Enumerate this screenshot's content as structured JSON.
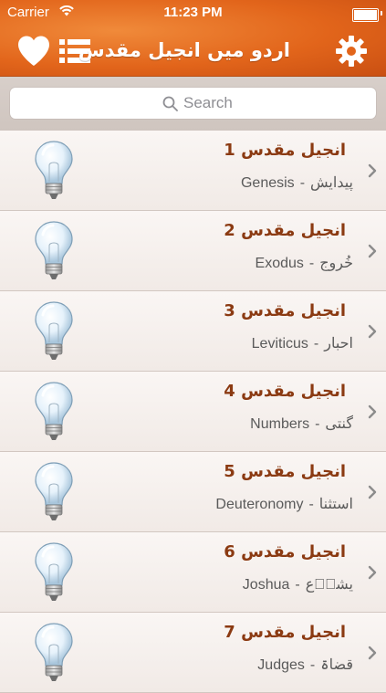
{
  "status_bar": {
    "carrier": "Carrier",
    "time": "11:23 PM"
  },
  "nav": {
    "title": "اردو میں انجیل مقدس",
    "left_icons": [
      "heart-icon",
      "list-icon"
    ],
    "right_icon": "gear-icon"
  },
  "search": {
    "placeholder": "Search"
  },
  "colors": {
    "header_orange": "#e2651b",
    "title_brown": "#8b3a12"
  },
  "books": [
    {
      "title": "انجیل مقدس 1",
      "urdu": "پیدایش",
      "english": "Genesis"
    },
    {
      "title": "انجیل مقدس 2",
      "urdu": "خُروج",
      "english": "Exodus"
    },
    {
      "title": "انجیل مقدس 3",
      "urdu": "احبار",
      "english": "Leviticus"
    },
    {
      "title": "انجیل مقدس 4",
      "urdu": "گنتی",
      "english": "Numbers"
    },
    {
      "title": "انجیل مقدس 5",
      "urdu": "استثنا",
      "english": "Deuteronomy"
    },
    {
      "title": "انجیل مقدس 6",
      "urdu": "یشوؔع",
      "english": "Joshua"
    },
    {
      "title": "انجیل مقدس 7",
      "urdu": "قضاۃ",
      "english": "Judges"
    }
  ],
  "separator": "-"
}
